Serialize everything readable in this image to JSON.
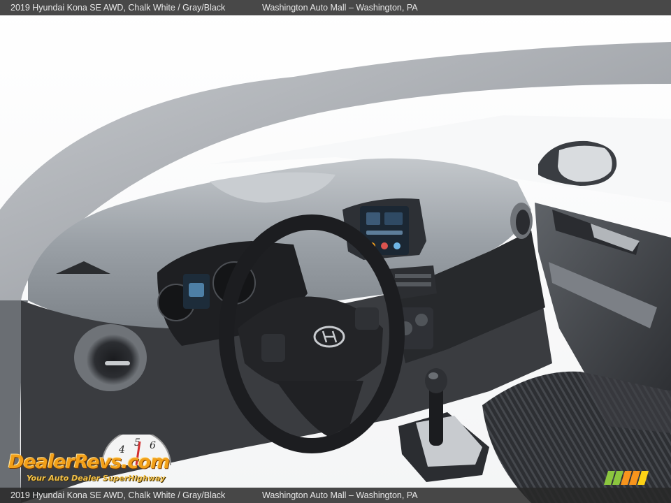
{
  "caption": {
    "car_info": "2019 Hyundai Kona SE AWD,   Chalk White / Gray/Black",
    "dealer_info": "Washington Auto Mall – Washington, PA"
  },
  "watermark": {
    "name": "DealerRevs.com",
    "tagline": "Your Auto Dealer SuperHighway",
    "gauge_digits": [
      "4",
      "5",
      "6"
    ]
  },
  "photo": {
    "subject": "2019 Hyundai Kona interior dashboard",
    "colors": {
      "dashboard": "#8e949a",
      "dark_trim": "#2a2c30",
      "seat": "#2f3135",
      "exterior_paint": "#b9bcc0",
      "screen": "#1b2733"
    }
  },
  "badge": {
    "icon": "stripes-badge-icon",
    "colors": [
      "#8bc63f",
      "#f7941d",
      "#fcd116"
    ]
  }
}
